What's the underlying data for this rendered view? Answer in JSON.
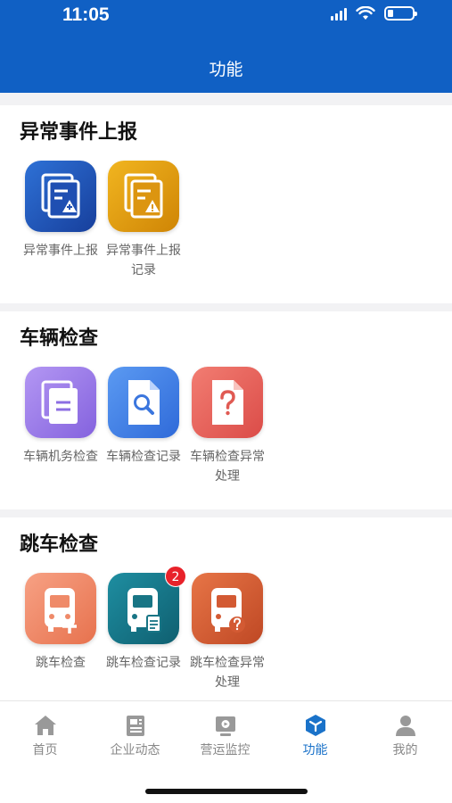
{
  "status_bar": {
    "time": "11:05",
    "signal_icon": "signal-icon",
    "wifi_icon": "wifi-icon",
    "battery_icon": "battery-icon"
  },
  "header": {
    "title": "功能",
    "color": "#1060c4"
  },
  "sections": [
    {
      "title": "异常事件上报",
      "tiles": [
        {
          "label": "异常事件上报",
          "icon": "report-add-icon",
          "color": "#1d5cc0"
        },
        {
          "label": "异常事件上报记录",
          "icon": "report-warning-icon",
          "color": "#e0a10b"
        }
      ]
    },
    {
      "title": "车辆检查",
      "tiles": [
        {
          "label": "车辆机务检查",
          "icon": "document-copy-icon",
          "color": "#9a7be8"
        },
        {
          "label": "车辆检查记录",
          "icon": "document-search-icon",
          "color": "#4485e8"
        },
        {
          "label": "车辆检查异常处理",
          "icon": "document-question-icon",
          "color": "#e9655e"
        }
      ]
    },
    {
      "title": "跳车检查",
      "tiles": [
        {
          "label": "跳车检查",
          "icon": "bus-add-icon",
          "color": "#f08a6a"
        },
        {
          "label": "跳车检查记录",
          "icon": "bus-record-icon",
          "color": "#177a8c",
          "badge": "2"
        },
        {
          "label": "跳车检查异常处理",
          "icon": "bus-question-icon",
          "color": "#d35a33"
        }
      ]
    }
  ],
  "tabbar": [
    {
      "label": "首页",
      "icon": "home-icon"
    },
    {
      "label": "企业动态",
      "icon": "news-icon"
    },
    {
      "label": "营运监控",
      "icon": "monitor-icon"
    },
    {
      "label": "功能",
      "icon": "function-cube-icon",
      "active": true
    },
    {
      "label": "我的",
      "icon": "profile-icon"
    }
  ],
  "accent_color": "#1a72c9"
}
